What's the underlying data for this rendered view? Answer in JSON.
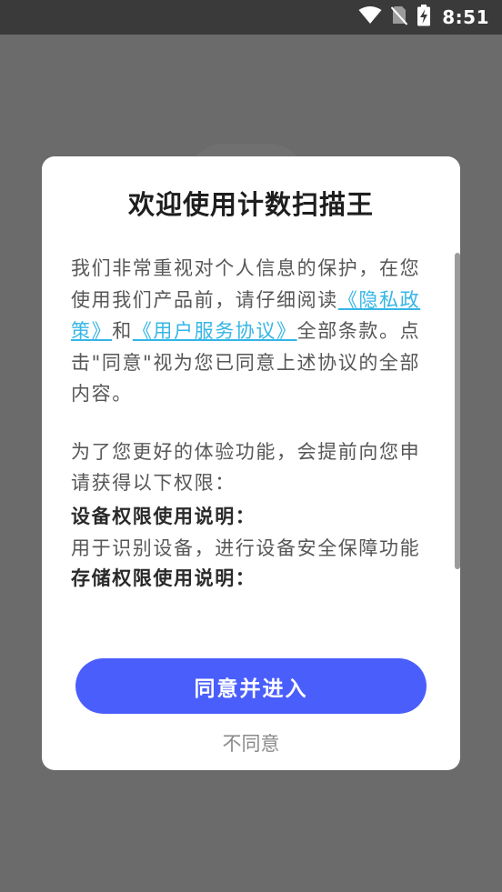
{
  "status_bar": {
    "time": "8:51",
    "icons": [
      "wifi-icon",
      "no-sim-icon",
      "battery-charging-icon"
    ]
  },
  "dialog": {
    "title": "欢迎使用计数扫描王",
    "intro": {
      "part1": "我们非常重视对个人信息的保护，在您使用我们产品前，请仔细阅读",
      "privacy_link": "《隐私政策》",
      "and": "和",
      "service_link": "《用户服务协议》",
      "part2": "全部条款。点击\"同意\"视为您已同意上述协议的全部内容。"
    },
    "permissions_intro": "为了您更好的体验功能，会提前向您申请获得以下权限：",
    "permissions": [
      {
        "title": "设备权限使用说明：",
        "desc": "用于识别设备，进行设备安全保障功能"
      },
      {
        "title": "存储权限使用说明：",
        "desc": ""
      }
    ],
    "agree_label": "同意并进入",
    "disagree_label": "不同意"
  },
  "colors": {
    "accent": "#4a5efc",
    "link": "#35b6e6",
    "overlay": "#6b6b6b",
    "status_bar": "#3a3a3a"
  }
}
